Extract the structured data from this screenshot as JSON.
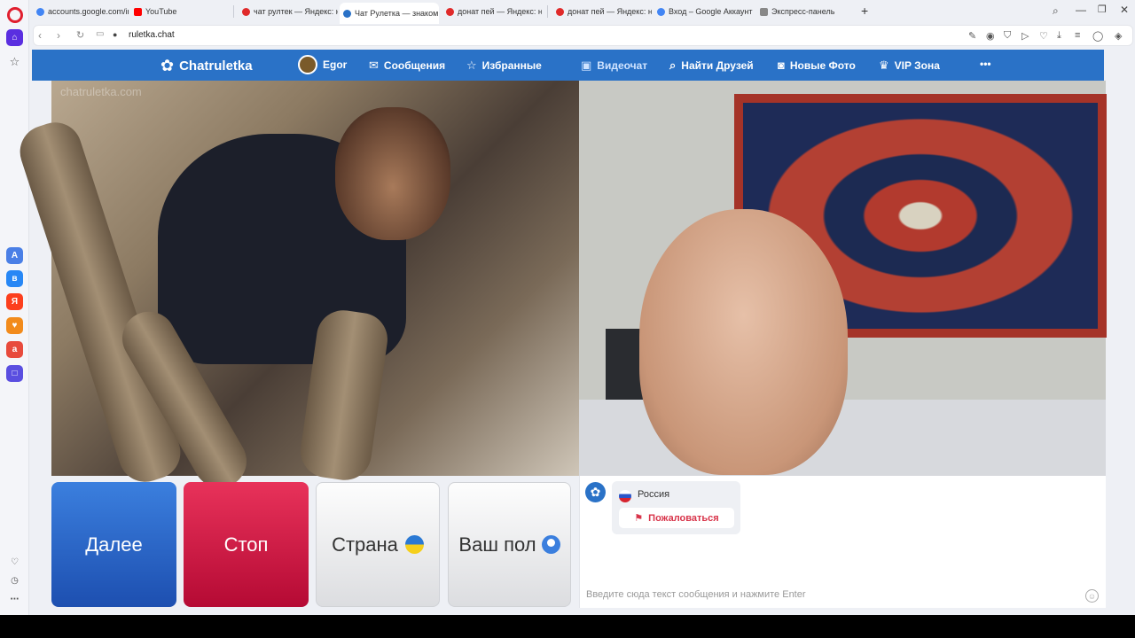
{
  "browser": {
    "tabs": [
      {
        "label": "accounts.google.com/info",
        "fav": "#4285f4"
      },
      {
        "label": "YouTube",
        "fav": "#ff0000"
      },
      {
        "label": "чат рултек — Яндекс: нал",
        "fav": "#e02a2a"
      },
      {
        "label": "Чат Рулетка — знаком",
        "fav": "#2a72c7"
      },
      {
        "label": "донат пей — Яндекс: нал",
        "fav": "#e02a2a"
      },
      {
        "label": "донат пей — Яндекс: нал",
        "fav": "#e02a2a"
      },
      {
        "label": "Вход – Google Аккаунты",
        "fav": "#4285f4"
      },
      {
        "label": "Экспресс-панель",
        "fav": "#888888"
      }
    ],
    "new_tab": "+",
    "url": "ruletka.chat"
  },
  "site": {
    "logo": "Chatruletka",
    "user": "Egor",
    "menu": {
      "messages": "Сообщения",
      "favorites": "Избранные",
      "videochat": "Видеочат",
      "find_friends": "Найти Друзей",
      "new_photo": "Новые Фото",
      "vip": "VIP Зона",
      "more": "•••"
    },
    "watermark": "chatruletka.com"
  },
  "controls": {
    "next": "Далее",
    "stop": "Стоп",
    "country": "Страна",
    "gender": "Ваш пол"
  },
  "chat": {
    "country": "Россия",
    "report": "Пожаловаться",
    "placeholder": "Введите сюда текст сообщения и нажмите Enter"
  },
  "colors": {
    "brand": "#2a72c7",
    "next": "#2f6fd0",
    "stop": "#d61a48"
  }
}
